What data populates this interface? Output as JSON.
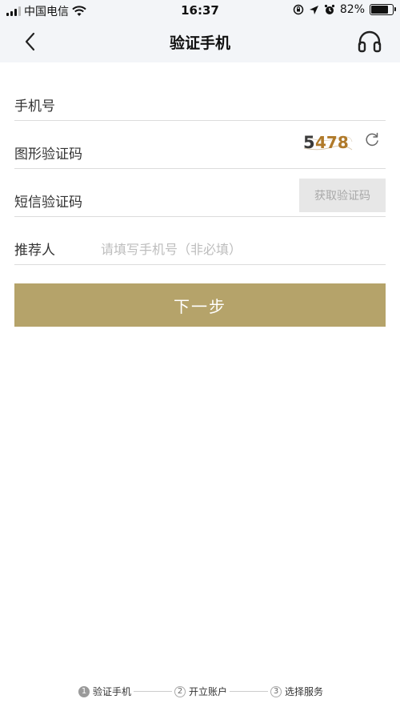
{
  "status_bar": {
    "carrier": "中国电信",
    "time": "16:37",
    "battery": "82%",
    "battery_level": 0.82
  },
  "nav": {
    "title": "验证手机",
    "back_icon": "chevron-left-icon",
    "support_icon": "headset-icon"
  },
  "form": {
    "phone_label": "手机号",
    "captcha_label": "图形验证码",
    "captcha_text": "5478",
    "sms_label": "短信验证码",
    "sms_button": "获取验证码",
    "referrer_label": "推荐人",
    "referrer_placeholder": "请填写手机号（非必填）"
  },
  "next_button": "下一步",
  "steps": [
    {
      "num": "1",
      "label": "验证手机",
      "active": true
    },
    {
      "num": "2",
      "label": "开立账户",
      "active": false
    },
    {
      "num": "3",
      "label": "选择服务",
      "active": false
    }
  ],
  "colors": {
    "accent": "#b5a36a",
    "header_bg": "#f3f5f8",
    "disabled_button_bg": "#e7e7e7"
  }
}
